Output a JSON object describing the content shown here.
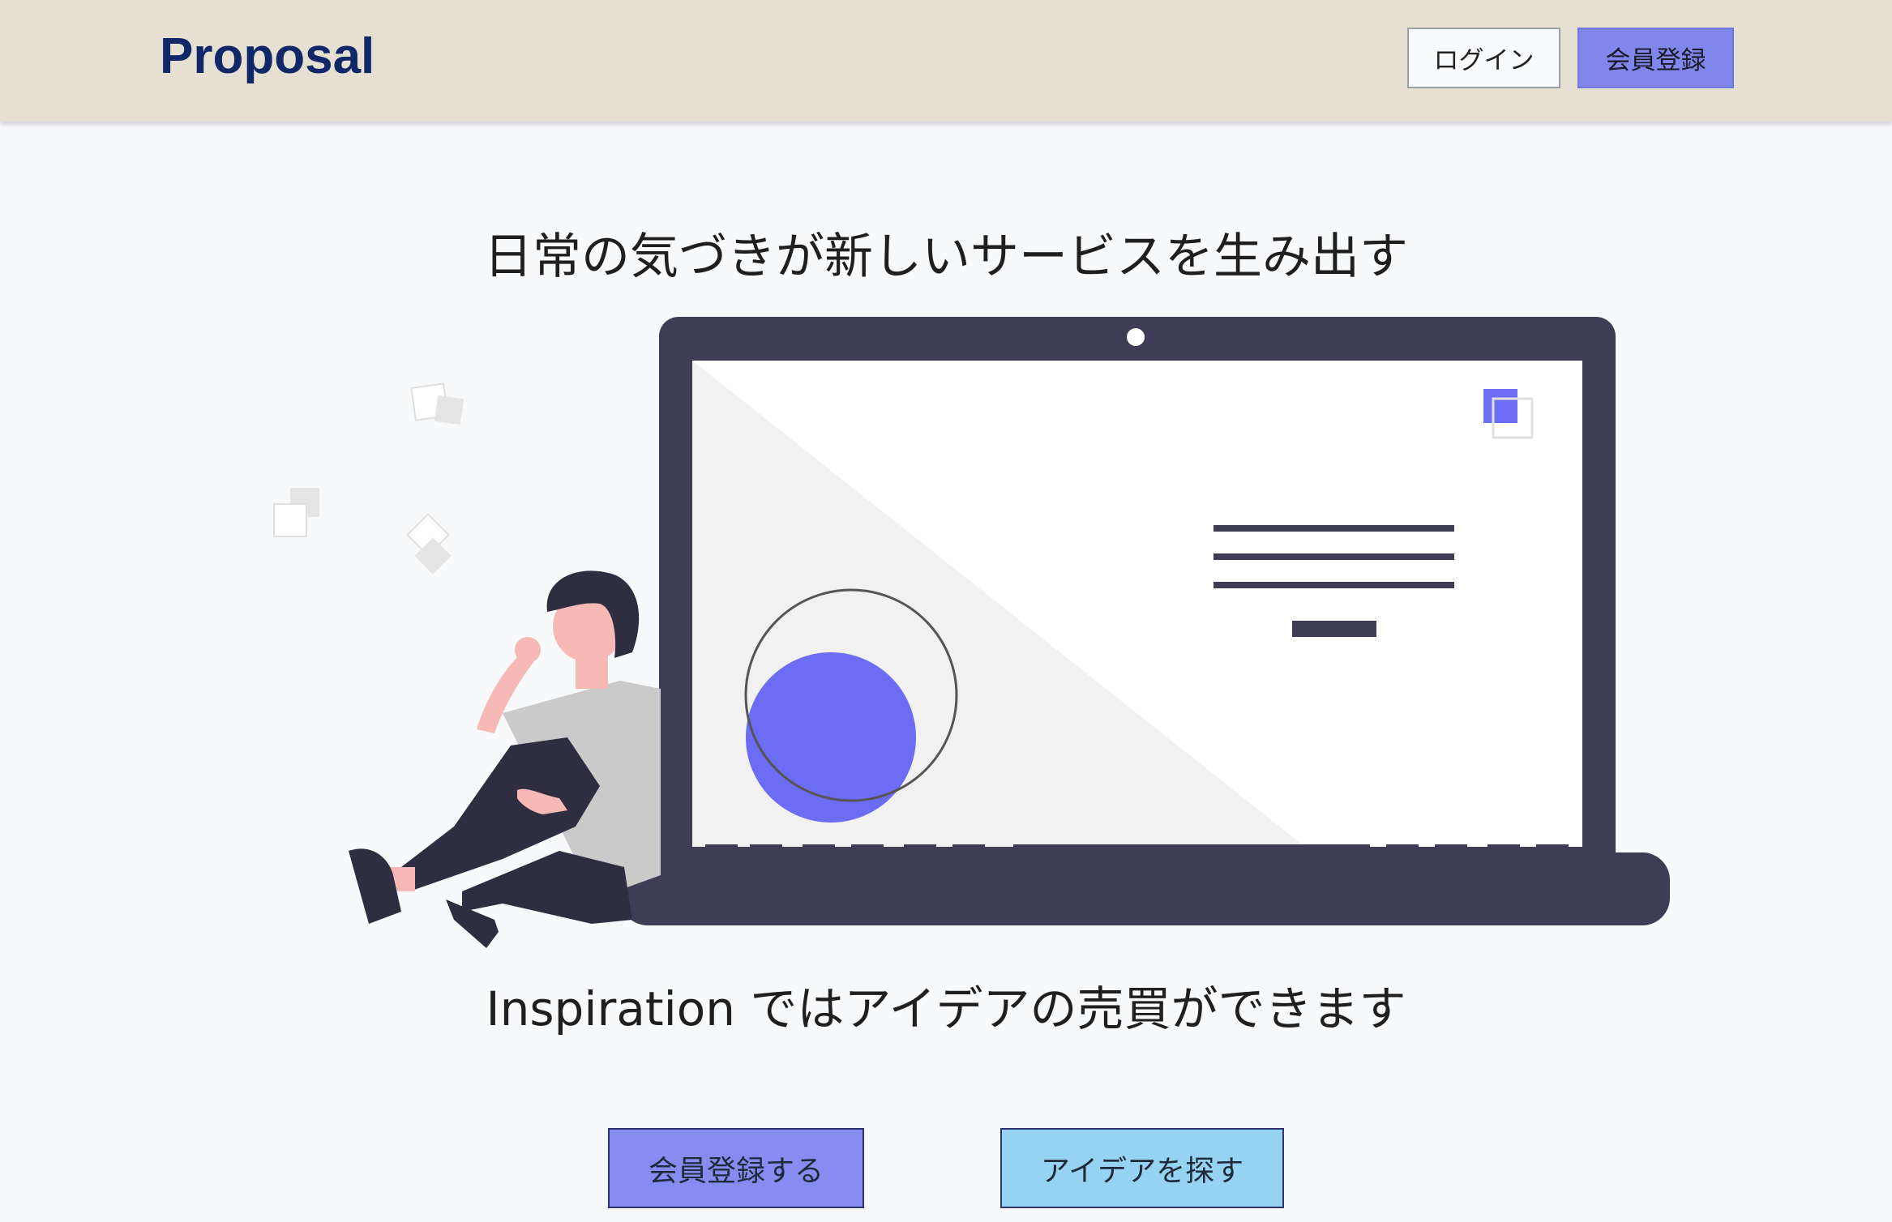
{
  "header": {
    "logo": "Proposal",
    "login_label": "ログイン",
    "register_label": "会員登録"
  },
  "hero": {
    "tagline": "日常の気づきが新しいサービスを生み出す",
    "subline": "Inspiration ではアイデアの売買ができます",
    "illustration": "person-leaning-on-laptop-illustration"
  },
  "actions": {
    "register_label": "会員登録する",
    "find_ideas_label": "アイデアを探す"
  },
  "colors": {
    "header_bg": "#e5e0d2",
    "brand": "#102768",
    "accent_purple": "#6c6cf5",
    "accent_blue": "#96d2f2",
    "laptop": "#3f3d55"
  }
}
